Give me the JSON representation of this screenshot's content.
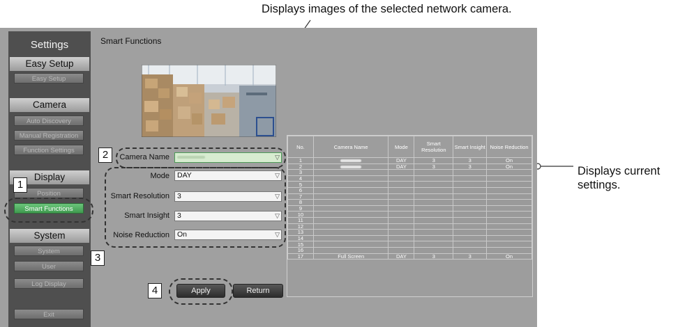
{
  "callouts": {
    "top": "Displays images of the selected network camera.",
    "right_line1": "Displays current",
    "right_line2": "settings."
  },
  "sidebar": {
    "title": "Settings",
    "sections": {
      "easy_setup": {
        "header": "Easy Setup",
        "items": [
          "Easy Setup"
        ]
      },
      "camera": {
        "header": "Camera",
        "items": [
          "Auto Discovery",
          "Manual Registration",
          "Function Settings"
        ]
      },
      "display": {
        "header": "Display",
        "items": [
          "Position",
          "Smart Functions"
        ]
      },
      "system": {
        "header": "System",
        "items": [
          "System",
          "User",
          "Log Display"
        ]
      }
    },
    "exit": "Exit"
  },
  "main": {
    "title": "Smart Functions",
    "camera_name_label": "Camera Name",
    "mode_label": "Mode",
    "mode_value": "DAY",
    "smart_resolution_label": "Smart Resolution",
    "smart_resolution_value": "3",
    "smart_insight_label": "Smart Insight",
    "smart_insight_value": "3",
    "noise_reduction_label": "Noise Reduction",
    "noise_reduction_value": "On",
    "apply": "Apply",
    "return": "Return"
  },
  "markers": [
    "1",
    "2",
    "3",
    "4"
  ],
  "table": {
    "headers": [
      "No.",
      "Camera Name",
      "Mode",
      "Smart Resolution",
      "Smart Insight",
      "Noise Reduction"
    ],
    "rows": [
      [
        "1",
        "",
        "DAY",
        "3",
        "3",
        "On"
      ],
      [
        "2",
        "",
        "DAY",
        "3",
        "3",
        "On"
      ],
      [
        "3",
        "",
        "",
        "",
        "",
        ""
      ],
      [
        "4",
        "",
        "",
        "",
        "",
        ""
      ],
      [
        "5",
        "",
        "",
        "",
        "",
        ""
      ],
      [
        "6",
        "",
        "",
        "",
        "",
        ""
      ],
      [
        "7",
        "",
        "",
        "",
        "",
        ""
      ],
      [
        "8",
        "",
        "",
        "",
        "",
        ""
      ],
      [
        "9",
        "",
        "",
        "",
        "",
        ""
      ],
      [
        "10",
        "",
        "",
        "",
        "",
        ""
      ],
      [
        "11",
        "",
        "",
        "",
        "",
        ""
      ],
      [
        "12",
        "",
        "",
        "",
        "",
        ""
      ],
      [
        "13",
        "",
        "",
        "",
        "",
        ""
      ],
      [
        "14",
        "",
        "",
        "",
        "",
        ""
      ],
      [
        "15",
        "",
        "",
        "",
        "",
        ""
      ],
      [
        "16",
        "",
        "",
        "",
        "",
        ""
      ],
      [
        "17",
        "Full Screen",
        "DAY",
        "3",
        "3",
        "On"
      ]
    ]
  }
}
